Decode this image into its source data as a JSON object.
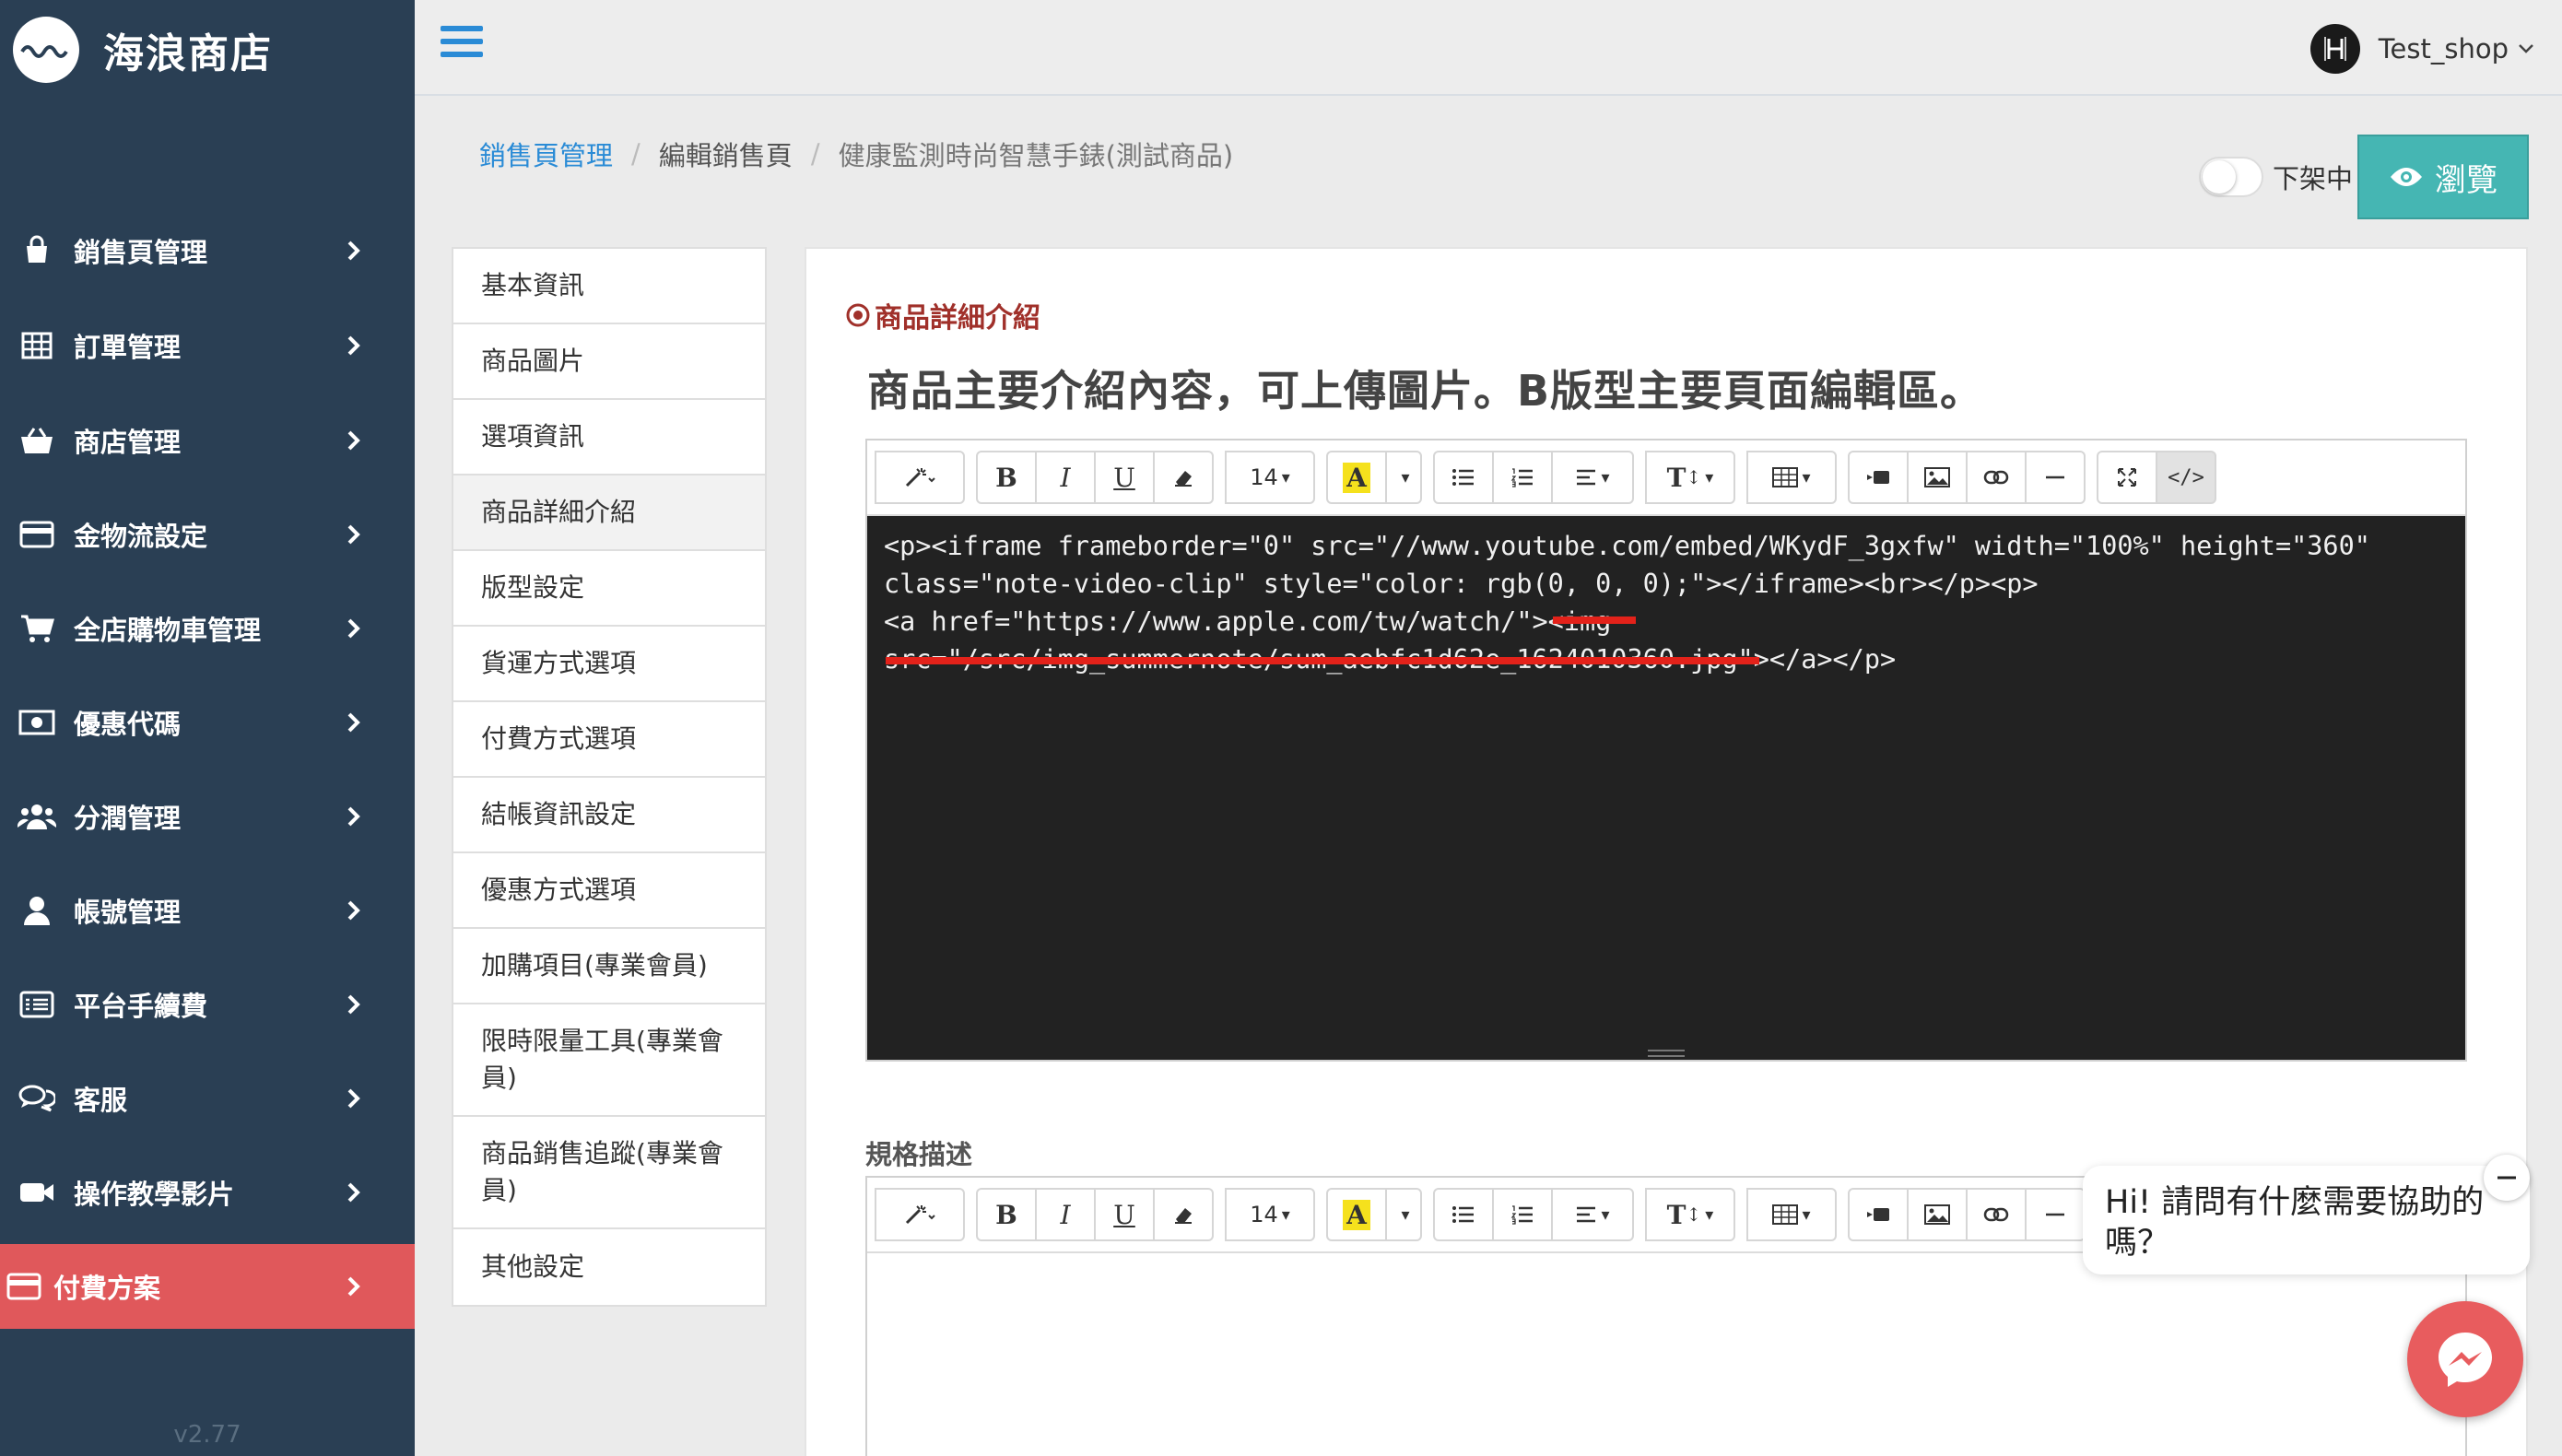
{
  "brand": {
    "name": "海浪商店"
  },
  "sidebar": {
    "items": [
      {
        "label": "銷售頁管理",
        "icon": "shopping-bag-icon"
      },
      {
        "label": "訂單管理",
        "icon": "table-icon"
      },
      {
        "label": "商店管理",
        "icon": "basket-icon"
      },
      {
        "label": "金物流設定",
        "icon": "credit-card-icon"
      },
      {
        "label": "全店購物車管理",
        "icon": "cart-icon"
      },
      {
        "label": "優惠代碼",
        "icon": "money-icon"
      },
      {
        "label": "分潤管理",
        "icon": "users-icon"
      },
      {
        "label": "帳號管理",
        "icon": "user-icon"
      },
      {
        "label": "平台手續費",
        "icon": "list-icon"
      },
      {
        "label": "客服",
        "icon": "comments-icon"
      },
      {
        "label": "操作教學影片",
        "icon": "video-camera-icon"
      },
      {
        "label": "付費方案",
        "icon": "credit-card-icon",
        "active": true
      }
    ],
    "version": "v2.77"
  },
  "topbar": {
    "user_name": "Test_shop",
    "avatar_letter": "H"
  },
  "breadcrumb": {
    "link": "銷售頁管理",
    "middle": "編輯銷售頁",
    "current": "健康監測時尚智慧手錶(測試商品)"
  },
  "status": {
    "label": "下架中",
    "enabled": false
  },
  "preview_button": {
    "label": "瀏覽"
  },
  "subnav": {
    "items": [
      "基本資訊",
      "商品圖片",
      "選項資訊",
      "商品詳細介紹",
      "版型設定",
      "貨運方式選項",
      "付費方式選項",
      "結帳資訊設定",
      "優惠方式選項",
      "加購項目(專業會員)",
      "限時限量工具(專業會員)",
      "商品銷售追蹤(專業會員)",
      "其他設定"
    ],
    "active_index": 3
  },
  "main": {
    "section_title": "商品詳細介紹",
    "heading": "商品主要介紹內容，可上傳圖片。B版型主要頁面編輯區。",
    "spec_label": "規格描述"
  },
  "editor": {
    "font_size": "14",
    "code_lines": [
      "<p><iframe frameborder=\"0\" src=\"//www.youtube.com/embed/WKydF_3gxfw\" width=\"100%\" height=\"360\"",
      "class=\"note-video-clip\" style=\"color: rgb(0, 0, 0);\"></iframe><br></p><p>",
      "<a href=\"https://www.apple.com/tw/watch/\"><img",
      "src=\"/src/img_summernote/sum_aebfc1d62e_1624010360.jpg\"></a></p>"
    ],
    "toolbar_labels": {
      "bold": "B",
      "italic": "I",
      "underline": "U",
      "highlight": "A"
    }
  },
  "chat": {
    "message": "Hi! 請問有什麼需要協助的嗎？"
  },
  "colors": {
    "sidebar_bg": "#2a3f54",
    "active_nav": "#e0585b",
    "link_blue": "#2a8bd6",
    "preview_teal": "#45b6b3",
    "section_red": "#a0302a",
    "messenger": "#e85c5e"
  }
}
